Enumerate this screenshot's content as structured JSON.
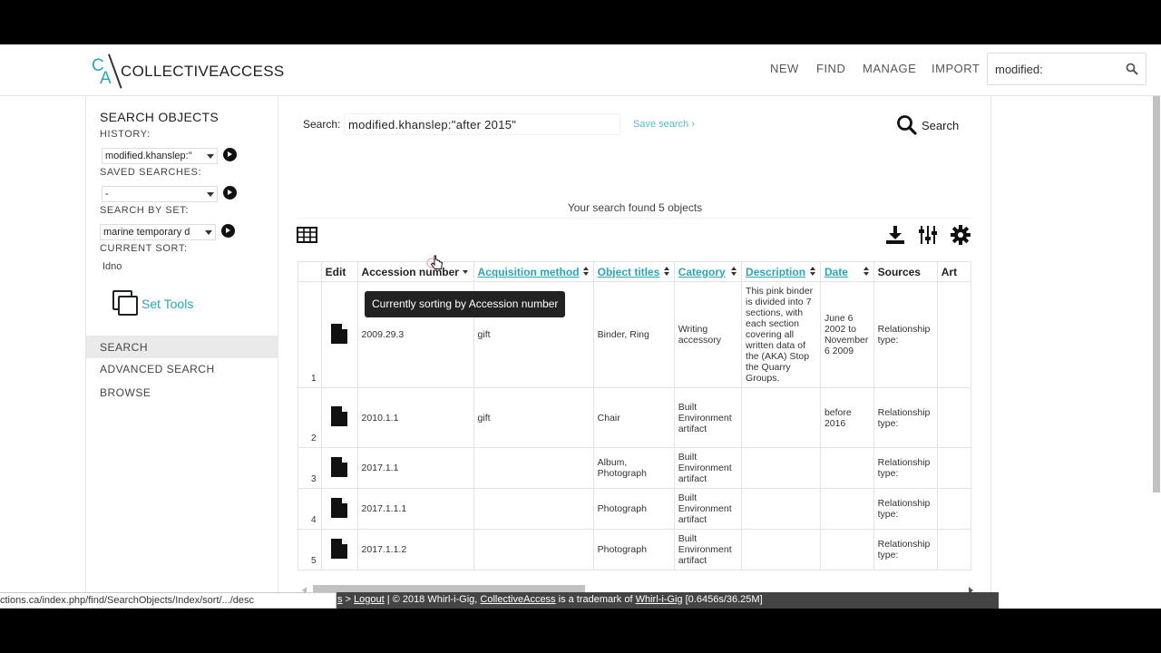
{
  "header": {
    "logo_text": "COLLECTIVEACCESS",
    "logo_mark_c": "C",
    "logo_mark_a": "A",
    "nav": [
      "NEW",
      "FIND",
      "MANAGE",
      "IMPORT"
    ],
    "search_value": "modified:"
  },
  "sidebar": {
    "title": "SEARCH OBJECTS",
    "history_label": "HISTORY:",
    "history_value": "modified.khanslep:\"",
    "saved_label": "SAVED SEARCHES:",
    "saved_value": "-",
    "set_label": "SEARCH BY SET:",
    "set_value": "marine temporary d",
    "sort_label": "CURRENT SORT:",
    "sort_value": "Idno",
    "set_tools": "Set Tools",
    "nav": [
      "SEARCH",
      "ADVANCED SEARCH",
      "BROWSE"
    ]
  },
  "main": {
    "search_label": "Search:",
    "search_value": "modified.khanslep:\"after 2015\"",
    "save_search": "Save search ›",
    "search_button": "Search",
    "found": "Your search found 5 objects",
    "tooltip": "Currently sorting by Accession number"
  },
  "table": {
    "headers": [
      "",
      "Edit",
      "Accession number",
      "Acquisition method",
      "Object titles",
      "Category",
      "Description",
      "Date",
      "Sources",
      "Art"
    ],
    "rows": [
      {
        "num": "1",
        "accession": "2009.29.3",
        "acquisition": "gift",
        "titles": "Binder, Ring",
        "category": "Writing accessory",
        "description": "This pink binder is divided into 7 sections, with each section covering all written data of the (AKA) Stop the Quarry Groups.",
        "date": "June 6 2002 to November 6 2009",
        "sources": "Relationship type:"
      },
      {
        "num": "2",
        "accession": "2010.1.1",
        "acquisition": "gift",
        "titles": "Chair",
        "category": "Built Environment artifact",
        "description": "",
        "date": "before 2016",
        "sources": "Relationship type:"
      },
      {
        "num": "3",
        "accession": "2017.1.1",
        "acquisition": "",
        "titles": "Album, Photograph",
        "category": "Built Environment artifact",
        "description": "",
        "date": "",
        "sources": "Relationship type:"
      },
      {
        "num": "4",
        "accession": "2017.1.1.1",
        "acquisition": "",
        "titles": "Photograph",
        "category": "Built Environment artifact",
        "description": "",
        "date": "",
        "sources": "Relationship type:"
      },
      {
        "num": "5",
        "accession": "2017.1.1.2",
        "acquisition": "",
        "titles": "Photograph",
        "category": "Built Environment artifact",
        "description": "",
        "date": "",
        "sources": "Relationship type:"
      }
    ]
  },
  "footer": {
    "status_url": "ctions.ca/index.php/find/SearchObjects/Index/sort/.../desc",
    "pre": "s",
    "sep1": " > ",
    "logout": "Logout",
    "sep2": "  |  © 2018 Whirl-i-Gig, ",
    "ca_link": "CollectiveAccess",
    "mid": " is a trademark of ",
    "wig_link": "Whirl-i-Gig",
    "timing": " [0.6456s/36.25M]"
  },
  "colors": {
    "accent": "#2aa6b3",
    "footer_bg": "#444444",
    "active_nav_bg": "#eaeaea"
  }
}
